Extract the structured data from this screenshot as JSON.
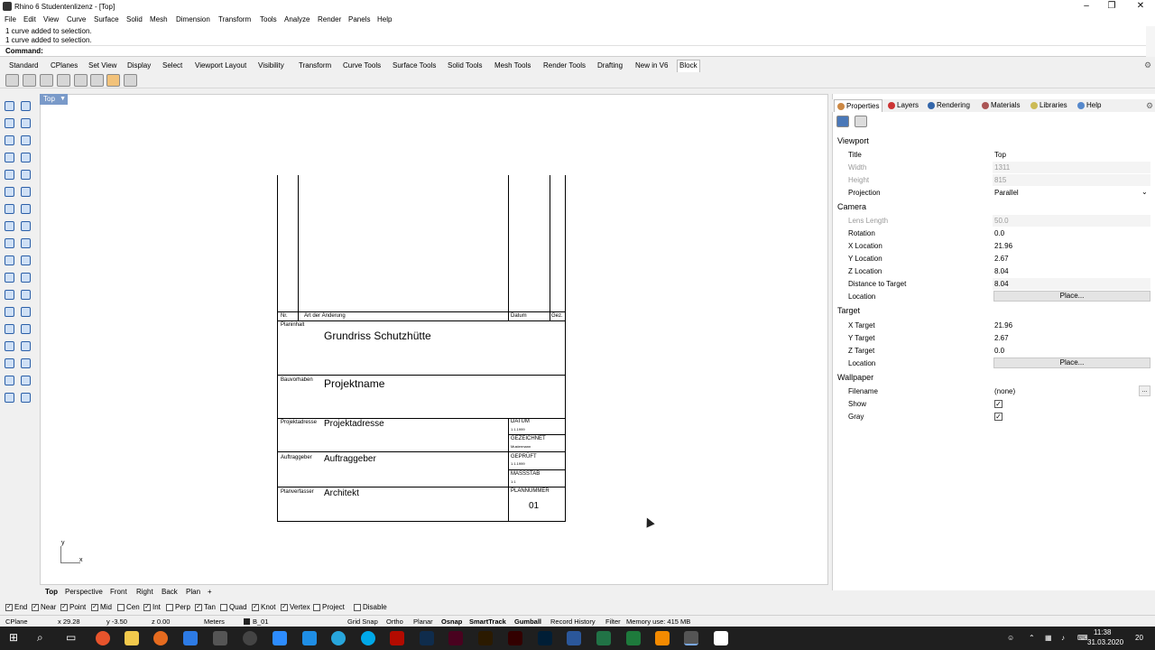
{
  "window": {
    "title": "Rhino 6 Studentenlizenz - [Top]",
    "controls": [
      "–",
      "❐",
      "✕"
    ]
  },
  "menu": [
    "File",
    "Edit",
    "View",
    "Curve",
    "Surface",
    "Solid",
    "Mesh",
    "Dimension",
    "Transform",
    "Tools",
    "Analyze",
    "Render",
    "Panels",
    "Help"
  ],
  "command_history": [
    "1 curve added to selection.",
    "1 curve added to selection."
  ],
  "command_prompt": "Command:",
  "toolbar_tabs": [
    "Standard",
    "CPlanes",
    "Set View",
    "Display",
    "Select",
    "Viewport Layout",
    "Visibility",
    "Transform",
    "Curve Tools",
    "Surface Tools",
    "Solid Tools",
    "Mesh Tools",
    "Render Tools",
    "Drafting",
    "New in V6",
    "Block"
  ],
  "active_toolbar_tab": "Block",
  "viewport": {
    "label": "Top",
    "axis_y": "y",
    "axis_x": "x"
  },
  "titleblock": {
    "nr": "Nr.",
    "art_der_aenderung": "Art der Änderung",
    "datum": "Datum",
    "gez": "Gez.",
    "planinhalt_label": "Planinhalt",
    "planinhalt_value": "Grundriss Schutzhütte",
    "bauvorhaben_label": "Bauvorhaben",
    "bauvorhaben_value": "Projektname",
    "projektadresse_label": "Projektadresse",
    "projektadresse_value": "Projektadresse",
    "datum_label": "DATUM",
    "datum_value": "1.1.1999",
    "gezeichnet_label": "GEZEICHNET",
    "gezeichnet_value": "Mustermann",
    "auftraggeber_label": "Auftraggeber",
    "auftraggeber_value": "Auftraggeber",
    "geprueft_label": "GEPRÜFT",
    "geprueft_value": "1.1.1999",
    "massstab_label": "MASSSTAB",
    "massstab_value": "1:1",
    "planverfasser_label": "Planverfasser",
    "planverfasser_value": "Architekt",
    "plannummer_label": "PLANNUMMER",
    "plannummer_value": "01"
  },
  "viewport_tabs": [
    "Top",
    "Perspective",
    "Front",
    "Right",
    "Back",
    "Plan",
    "+"
  ],
  "osnaps": [
    {
      "label": "End",
      "checked": true
    },
    {
      "label": "Near",
      "checked": true
    },
    {
      "label": "Point",
      "checked": true
    },
    {
      "label": "Mid",
      "checked": true
    },
    {
      "label": "Cen",
      "checked": false
    },
    {
      "label": "Int",
      "checked": true
    },
    {
      "label": "Perp",
      "checked": false
    },
    {
      "label": "Tan",
      "checked": true
    },
    {
      "label": "Quad",
      "checked": false
    },
    {
      "label": "Knot",
      "checked": true
    },
    {
      "label": "Vertex",
      "checked": true
    },
    {
      "label": "Project",
      "checked": false
    },
    {
      "label": "Disable",
      "checked": false
    }
  ],
  "status": {
    "cplane": "CPlane",
    "x": "x 29.28",
    "y": "y -3.50",
    "z": "z 0.00",
    "units": "Meters",
    "layer": "B_01",
    "grid_snap": "Grid Snap",
    "ortho": "Ortho",
    "planar": "Planar",
    "osnap": "Osnap",
    "smarttrack": "SmartTrack",
    "gumball": "Gumball",
    "record_history": "Record History",
    "filter": "Filter",
    "memory": "Memory use: 415 MB"
  },
  "panel": {
    "tabs": [
      "Properties",
      "Layers",
      "Rendering",
      "Materials",
      "Libraries",
      "Help"
    ],
    "sections": {
      "viewport": "Viewport",
      "camera": "Camera",
      "target": "Target",
      "wallpaper": "Wallpaper"
    },
    "viewport_rows": [
      {
        "k": "Title",
        "v": "Top",
        "dis": false
      },
      {
        "k": "Width",
        "v": "1311",
        "dis": true
      },
      {
        "k": "Height",
        "v": "815",
        "dis": true
      },
      {
        "k": "Projection",
        "v": "Parallel",
        "dis": false
      }
    ],
    "camera_rows": [
      {
        "k": "Lens Length",
        "v": "50.0",
        "dis": true
      },
      {
        "k": "Rotation",
        "v": "0.0",
        "dis": false
      },
      {
        "k": "X Location",
        "v": "21.96",
        "dis": false
      },
      {
        "k": "Y Location",
        "v": "2.67",
        "dis": false
      },
      {
        "k": "Z Location",
        "v": "8.04",
        "dis": false
      },
      {
        "k": "Distance to Target",
        "v": "8.04",
        "dis": false
      },
      {
        "k": "Location",
        "v": "Place...",
        "dis": false
      }
    ],
    "target_rows": [
      {
        "k": "X Target",
        "v": "21.96",
        "dis": false
      },
      {
        "k": "Y Target",
        "v": "2.67",
        "dis": false
      },
      {
        "k": "Z Target",
        "v": "0.0",
        "dis": false
      },
      {
        "k": "Location",
        "v": "Place...",
        "dis": false
      }
    ],
    "wallpaper_rows": [
      {
        "k": "Filename",
        "v": "(none)",
        "dis": false
      },
      {
        "k": "Show",
        "v": "",
        "dis": false
      },
      {
        "k": "Gray",
        "v": "",
        "dis": false
      }
    ],
    "filename_btn": "..."
  },
  "taskbar": {
    "time": "11:38",
    "date": "31.03.2020",
    "notif": "20"
  }
}
